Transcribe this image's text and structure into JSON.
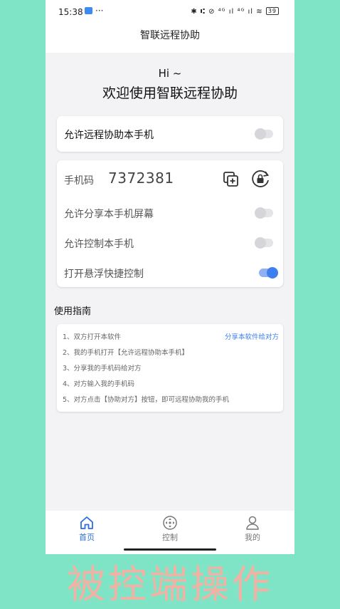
{
  "status_bar": {
    "time": "15:38",
    "more": "···",
    "right_icons": "✱ ⑆ ⊘ ⁴ᴳ ıl ⁴ᴳ ıl ≋",
    "battery": "39"
  },
  "header": {
    "title": "智联远程协助"
  },
  "hero": {
    "greeting": "Hi ~",
    "title": "欢迎使用智联远程协助"
  },
  "remote_card": {
    "label": "允许远程协助本手机",
    "enabled": false
  },
  "phone_card": {
    "code_label": "手机码",
    "code_value": "7372381",
    "rows": [
      {
        "label": "允许分享本手机屏幕",
        "enabled": false
      },
      {
        "label": "允许控制本手机",
        "enabled": false
      },
      {
        "label": "打开悬浮快捷控制",
        "enabled": true
      }
    ]
  },
  "guide": {
    "title": "使用指南",
    "share_link": "分享本软件给对方",
    "steps": [
      "1、双方打开本软件",
      "2、我的手机打开【允许远程协助本手机】",
      "3、分享我的手机码给对方",
      "4、对方输入我的手机码",
      "5、对方点击【协助对方】按钮，即可远程协助我的手机"
    ]
  },
  "tabs": [
    {
      "label": "首页",
      "icon": "home-icon",
      "active": true
    },
    {
      "label": "控制",
      "icon": "control-icon",
      "active": false
    },
    {
      "label": "我的",
      "icon": "user-icon",
      "active": false
    }
  ],
  "caption": "被控端操作",
  "colors": {
    "background": "#7fe3c6",
    "accent": "#3d7ff0",
    "caption": "#f3b1a4"
  }
}
